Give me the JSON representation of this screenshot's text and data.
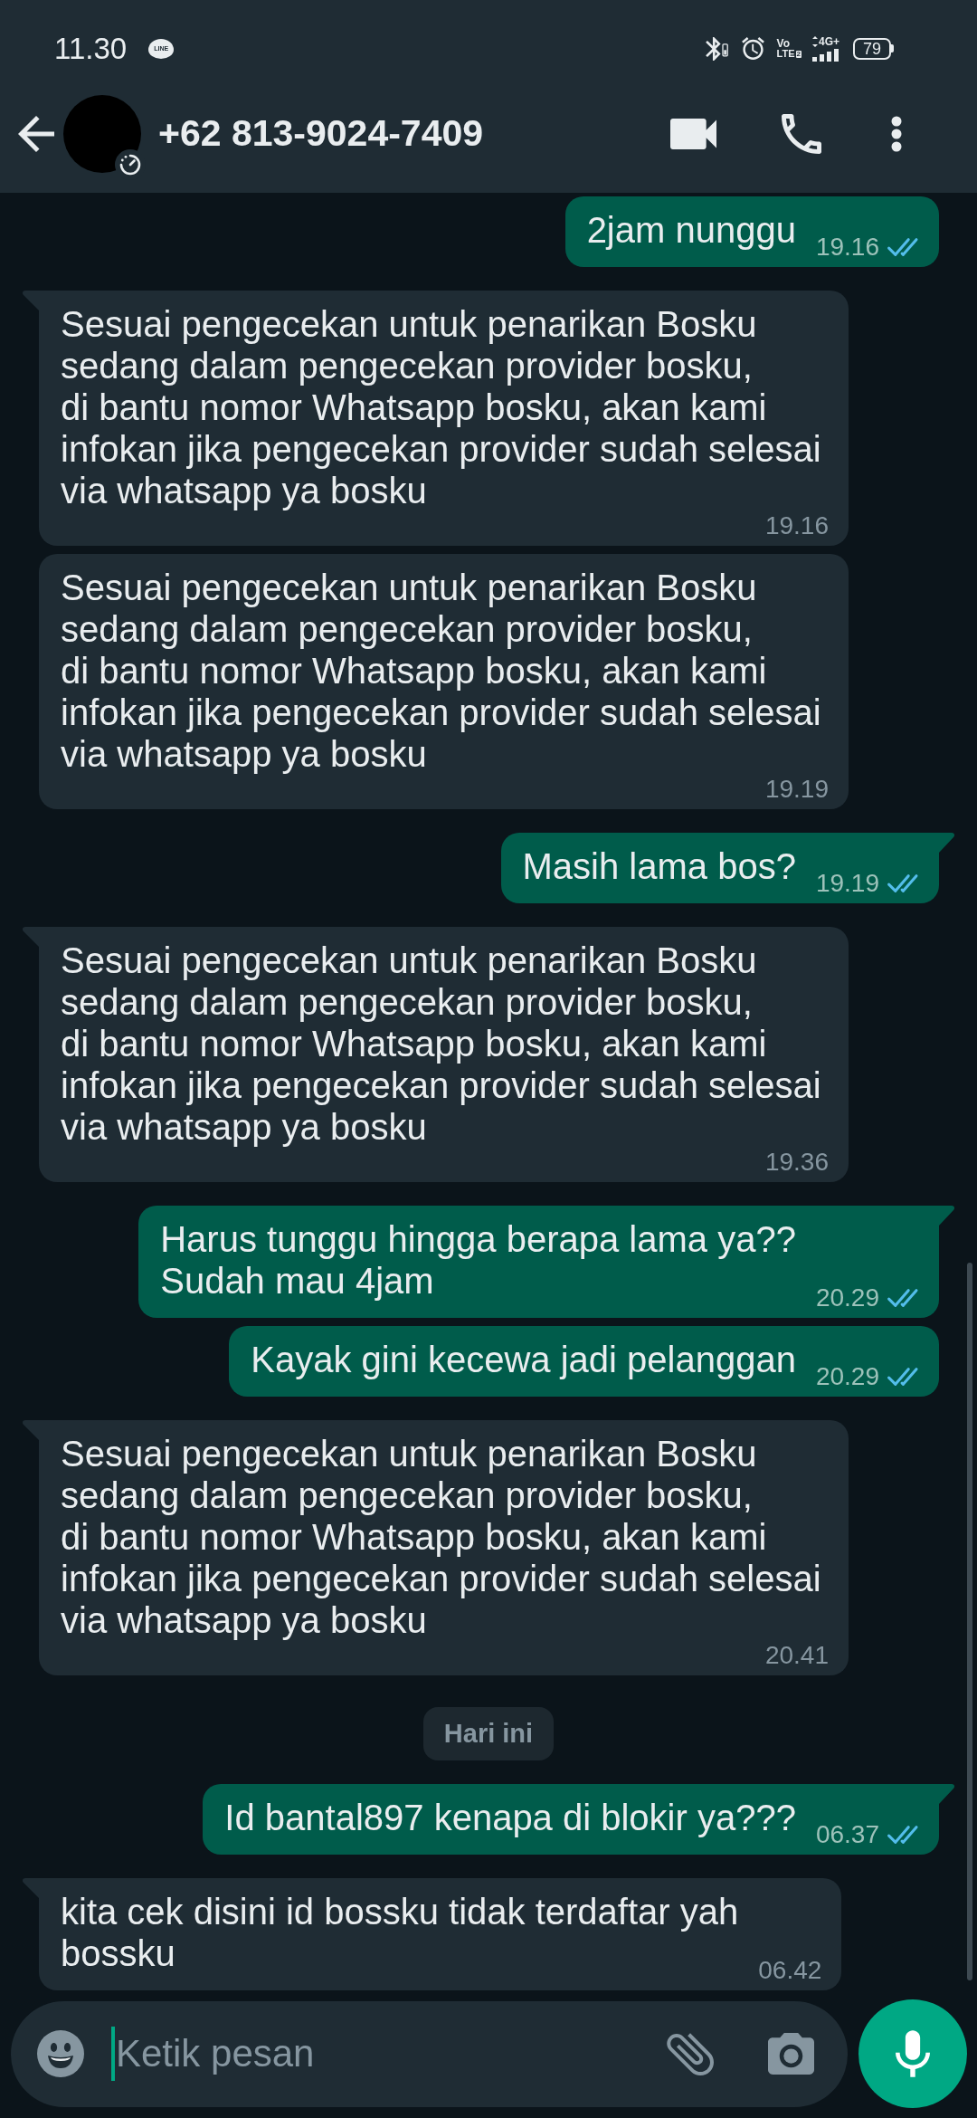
{
  "status_bar": {
    "time": "11.30",
    "notification": {
      "label": "LINE"
    },
    "volte": {
      "top": "Vo",
      "bottom": "LTE",
      "sim": "2"
    },
    "network": "4G+",
    "battery": "79"
  },
  "header": {
    "title": "+62 813-9024-7409"
  },
  "messages": [
    {
      "kind": "outgoing",
      "tail": false,
      "text": "2jam nunggu",
      "time": "19.16",
      "read": true
    },
    {
      "kind": "incoming",
      "tail": true,
      "text": "Sesuai pengecekan untuk penarikan Bosku\nsedang dalam pengecekan provider bosku,\ndi bantu nomor Whatsapp bosku, akan kami\ninfokan jika pengecekan provider sudah selesai\nvia whatsapp ya bosku",
      "time": "19.16"
    },
    {
      "kind": "incoming",
      "tail": false,
      "text": "Sesuai pengecekan untuk penarikan Bosku\nsedang dalam pengecekan provider bosku,\ndi bantu nomor Whatsapp bosku, akan kami\ninfokan jika pengecekan provider sudah selesai\nvia whatsapp ya bosku",
      "time": "19.19"
    },
    {
      "kind": "outgoing",
      "tail": true,
      "text": "Masih lama bos?",
      "time": "19.19",
      "read": true
    },
    {
      "kind": "incoming",
      "tail": true,
      "text": "Sesuai pengecekan untuk penarikan Bosku\nsedang dalam pengecekan provider bosku,\ndi bantu nomor Whatsapp bosku, akan kami\ninfokan jika pengecekan provider sudah selesai\nvia whatsapp ya bosku",
      "time": "19.36"
    },
    {
      "kind": "outgoing",
      "tail": true,
      "text": "Harus tunggu hingga berapa lama ya??\nSudah mau 4jam",
      "time": "20.29",
      "read": true
    },
    {
      "kind": "outgoing",
      "tail": false,
      "text": "Kayak gini kecewa jadi pelanggan",
      "time": "20.29",
      "read": true
    },
    {
      "kind": "incoming",
      "tail": true,
      "text": "Sesuai pengecekan untuk penarikan Bosku\nsedang dalam pengecekan provider bosku,\ndi bantu nomor Whatsapp bosku, akan kami\ninfokan jika pengecekan provider sudah selesai\nvia whatsapp ya bosku",
      "time": "20.41"
    },
    {
      "kind": "date",
      "text": "Hari ini"
    },
    {
      "kind": "outgoing",
      "tail": true,
      "text": "Id bantal897 kenapa di blokir ya???",
      "time": "06.37",
      "read": true
    },
    {
      "kind": "incoming",
      "tail": true,
      "text": "kita cek disini id bossku tidak terdaftar yah\nbossku",
      "time": "06.42"
    }
  ],
  "composer": {
    "placeholder": "Ketik pesan"
  }
}
